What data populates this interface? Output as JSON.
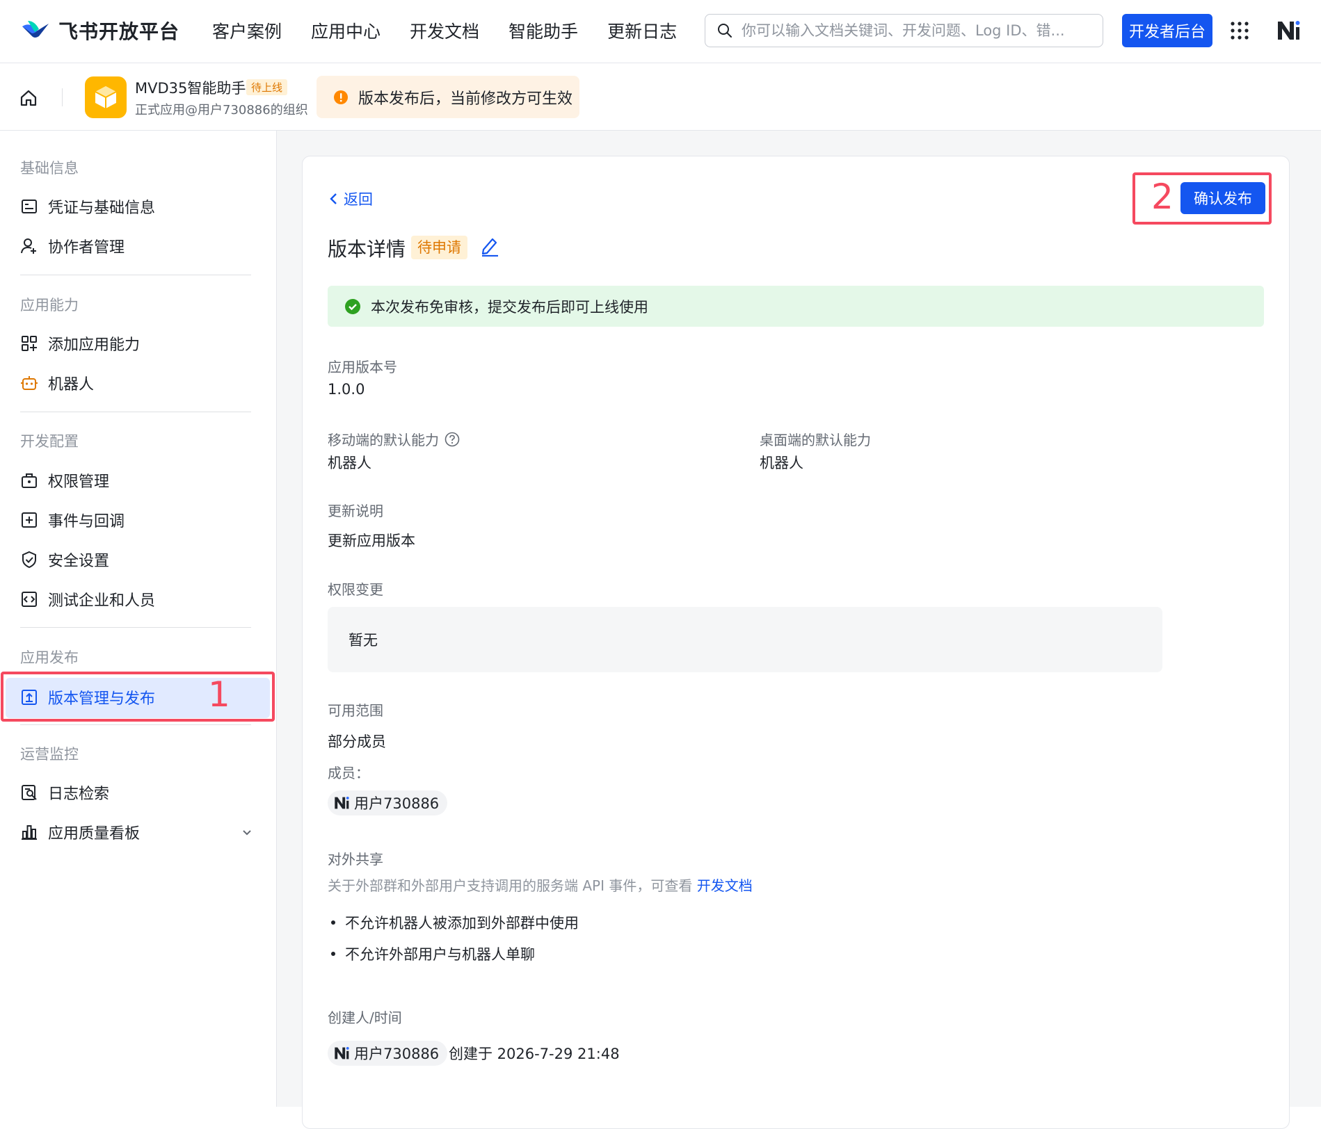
{
  "header": {
    "logo_text": "飞书开放平台",
    "nav": [
      "客户案例",
      "应用中心",
      "开发文档",
      "智能助手",
      "更新日志"
    ],
    "search_placeholder": "你可以输入文档关键词、开发问题、Log ID、错...",
    "dev_console_label": "开发者后台"
  },
  "app_bar": {
    "app_name": "MVD35智能助手",
    "app_tag": "待上线",
    "app_org": "正式应用@用户730886的组织",
    "notice": "版本发布后，当前修改方可生效"
  },
  "sidebar": {
    "sections": [
      {
        "title": "基础信息",
        "items": [
          "凭证与基础信息",
          "协作者管理"
        ]
      },
      {
        "title": "应用能力",
        "items": [
          "添加应用能力",
          "机器人"
        ]
      },
      {
        "title": "开发配置",
        "items": [
          "权限管理",
          "事件与回调",
          "安全设置",
          "测试企业和人员"
        ]
      },
      {
        "title": "应用发布",
        "items": [
          "版本管理与发布"
        ]
      },
      {
        "title": "运营监控",
        "items": [
          "日志检索",
          "应用质量看板"
        ]
      }
    ],
    "active_item": "版本管理与发布"
  },
  "annotations": {
    "one": "1",
    "two": "2"
  },
  "main": {
    "back_label": "返回",
    "title": "版本详情",
    "status": "待申请",
    "confirm_label": "确认发布",
    "banner": "本次发布免审核，提交发布后即可上线使用",
    "version_label": "应用版本号",
    "version_value": "1.0.0",
    "mobile_label": "移动端的默认能力",
    "mobile_value": "机器人",
    "desktop_label": "桌面端的默认能力",
    "desktop_value": "机器人",
    "notes_label": "更新说明",
    "notes_value": "更新应用版本",
    "perm_label": "权限变更",
    "perm_value": "暂无",
    "scope_label": "可用范围",
    "scope_value": "部分成员",
    "members_label": "成员：",
    "member_name": "用户730886",
    "share_label": "对外共享",
    "share_desc": "关于外部群和外部用户支持调用的服务端 API 事件，可查看",
    "share_link": "开发文档",
    "share_items": [
      "不允许机器人被添加到外部群中使用",
      "不允许外部用户与机器人单聊"
    ],
    "creator_label": "创建人/时间",
    "creator_name": "用户730886",
    "created_at": "创建于 2026-7-29 21:48"
  },
  "colors": {
    "accent": "#1456f0",
    "warning": "#de7802",
    "success": "#2ea121",
    "annotation": "#f5495f"
  }
}
